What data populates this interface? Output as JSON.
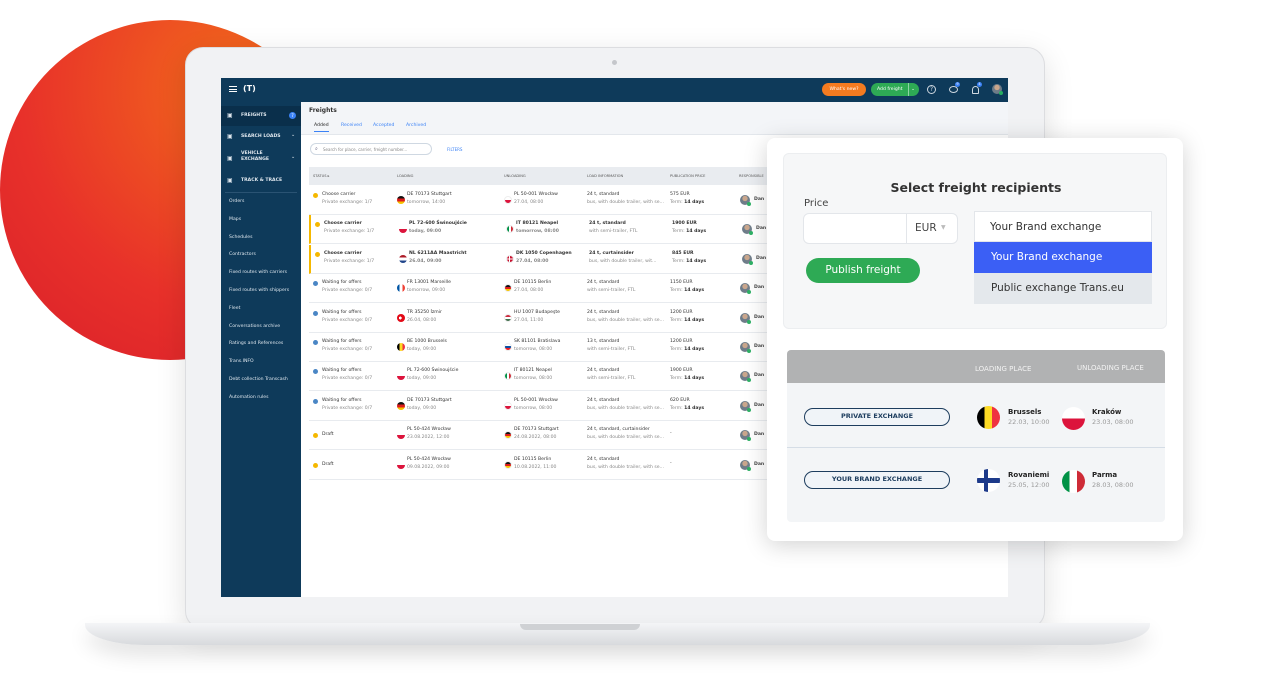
{
  "topbar": {
    "whats_new": "What's new?",
    "add_freight": "Add freight",
    "messages_badge": "9",
    "notifications_badge": "4"
  },
  "sidebar": {
    "main": [
      {
        "label": "FREIGHTS",
        "badge": "7",
        "icon": "freight-icon"
      },
      {
        "label": "SEARCH LOADS",
        "icon": "box-icon"
      },
      {
        "label": "VEHICLE EXCHANGE",
        "icon": "truck-icon"
      },
      {
        "label": "TRACK & TRACE",
        "icon": "track-icon"
      }
    ],
    "items": [
      "Orders",
      "Maps",
      "Schedules",
      "Contractors",
      "Fixed routes with carriers",
      "Fixed routes with shippers",
      "Fleet",
      "Conversations archive",
      "Ratings and References",
      "Trans.INFO",
      "Debt collection Transcash",
      "Automation rules"
    ]
  },
  "main": {
    "title": "Freights",
    "tabs": [
      "Added",
      "Received",
      "Accepted",
      "Archived"
    ],
    "search_placeholder": "Search for place, carrier, freight number...",
    "filters": "FILTERS",
    "columns": [
      "STATUS ▸",
      "LOADING",
      "UNLOADING",
      "LOAD INFORMATION",
      "PUBLICATION PRICE",
      "RESPONSIBLE"
    ],
    "rows": [
      {
        "status": "Choose carrier",
        "sub": "Private exchange: 1/7",
        "icon": "warning",
        "bold": false,
        "lf": "DE",
        "load": "DE 70173 Stuttgart",
        "ld": "tomorrow, 14:00",
        "uf": "PL",
        "unload": "PL 50-001 Wrocław",
        "ud": "27.04, 08:00",
        "info": "24 t, standard",
        "info2": "bus, with double trailer, with se...",
        "price": "575 EUR",
        "term": "14 days",
        "resp": "Dan"
      },
      {
        "status": "Choose carrier",
        "sub": "Private exchange: 1/7",
        "icon": "warning",
        "bold": true,
        "lf": "PL",
        "load": "PL 72-600 Świnoujście",
        "ld": "today, 09:00",
        "uf": "IT",
        "unload": "IT 80121 Neapel",
        "ud": "tomorrow, 08:00",
        "info": "24 t, standard",
        "info2": "with semi-trailer, FTL",
        "price": "1900 EUR",
        "term": "14 days",
        "resp": "Dan"
      },
      {
        "status": "Choose carrier",
        "sub": "Private exchange: 1/7",
        "icon": "warning",
        "bold": true,
        "lf": "NL",
        "load": "NL 6211AA Maastricht",
        "ld": "26.04, 09:00",
        "uf": "DK",
        "unload": "DK 1050 Copenhagen",
        "ud": "27.04, 08:00",
        "info": "24 t, curtainsider",
        "info2": "bus, with double trailer, wit...",
        "price": "845 EUR",
        "term": "14 days",
        "resp": "Dan"
      },
      {
        "status": "Waiting for offers",
        "sub": "Private exchange: 0/7",
        "icon": "clock",
        "bold": false,
        "lf": "FR",
        "load": "FR 13001 Marseille",
        "ld": "tomorrow, 09:00",
        "uf": "DE",
        "unload": "DE 10115 Berlin",
        "ud": "27.04, 08:00",
        "info": "24 t, standard",
        "info2": "with semi-trailer, FTL",
        "price": "1150 EUR",
        "term": "14 days",
        "resp": "Dan"
      },
      {
        "status": "Waiting for offers",
        "sub": "Private exchange: 0/7",
        "icon": "clock",
        "bold": false,
        "lf": "TR",
        "load": "TR 35250 İzmir",
        "ld": "26.04, 08:00",
        "uf": "HU",
        "unload": "HU 1007 Budapeşte",
        "ud": "27.04, 11:00",
        "info": "24 t, standard",
        "info2": "bus, with double trailer, with se...",
        "price": "1200 EUR",
        "term": "14 days",
        "resp": "Dan"
      },
      {
        "status": "Waiting for offers",
        "sub": "Private exchange: 0/7",
        "icon": "clock",
        "bold": false,
        "lf": "BE",
        "load": "BE 1000 Brussels",
        "ld": "today, 09:00",
        "uf": "SK",
        "unload": "SK 81101 Bratislava",
        "ud": "tomorrow, 08:00",
        "info": "13 t, standard",
        "info2": "with semi-trailer, FTL",
        "price": "1200 EUR",
        "term": "14 days",
        "resp": "Dan"
      },
      {
        "status": "Waiting for offers",
        "sub": "Private exchange: 0/7",
        "icon": "clock",
        "bold": false,
        "lf": "PL",
        "load": "PL 72-600 Świnoujście",
        "ld": "today, 09:00",
        "uf": "IT",
        "unload": "IT 80121 Neapel",
        "ud": "tomorrow, 08:00",
        "info": "24 t, standard",
        "info2": "with semi-trailer, FTL",
        "price": "1900 EUR",
        "term": "14 days",
        "resp": "Dan"
      },
      {
        "status": "Waiting for offers",
        "sub": "Private exchange: 0/7",
        "icon": "clock",
        "bold": false,
        "lf": "DE",
        "load": "DE 70173 Stuttgart",
        "ld": "today, 09:00",
        "uf": "PL",
        "unload": "PL 50-001 Wrocław",
        "ud": "tomorrow, 08:00",
        "info": "24 t, standard",
        "info2": "bus, with double trailer, with se...",
        "price": "620 EUR",
        "term": "14 days",
        "resp": "Dan"
      },
      {
        "status": "Draft",
        "sub": "",
        "icon": "warning",
        "bold": false,
        "lf": "PL",
        "load": "PL 50-424 Wrocław",
        "ld": "23.08.2022, 12:00",
        "uf": "DE",
        "unload": "DE 70173 Stuttgart",
        "ud": "24.08.2022, 08:00",
        "info": "24 t, standard, curtainsider",
        "info2": "bus, with double trailer, with se...",
        "price": "-",
        "term": "",
        "resp": "Dan"
      },
      {
        "status": "Draft",
        "sub": "",
        "icon": "warning",
        "bold": false,
        "lf": "PL",
        "load": "PL 50-424 Wrocław",
        "ld": "09.08.2022, 09:00",
        "uf": "DE",
        "unload": "DE 10115 Berlin",
        "ud": "10.08.2022, 11:00",
        "info": "24 t, standard",
        "info2": "bus, with double trailer, with se...",
        "price": "-",
        "term": "",
        "resp": "Dan"
      }
    ],
    "term_label": "Term: "
  },
  "popup": {
    "title": "Select freight recipients",
    "price_label": "Price",
    "price_value": "",
    "currency": "EUR",
    "publish": "Publish freight",
    "dropdown_selected": "Your Brand exchange",
    "options": [
      "Your Brand exchange",
      "Public exchange Trans.eu"
    ],
    "accent": "#3b5ff5",
    "publish_color": "#2eaa55"
  },
  "exchanges": {
    "col_loading": "LOADING PLACE",
    "col_unloading": "UNLOADING PLACE",
    "rows": [
      {
        "label": "PRIVATE EXCHANGE",
        "lf": "BE",
        "from": "Brussels",
        "fd": "22.03, 10:00",
        "uf": "PL",
        "to": "Kraków",
        "td": "23.03, 08:00"
      },
      {
        "label": "YOUR BRAND EXCHANGE",
        "lf": "FI",
        "from": "Rovaniemi",
        "fd": "25.05, 12:00",
        "uf": "IT",
        "to": "Parma",
        "td": "28.03, 08:00"
      }
    ]
  }
}
